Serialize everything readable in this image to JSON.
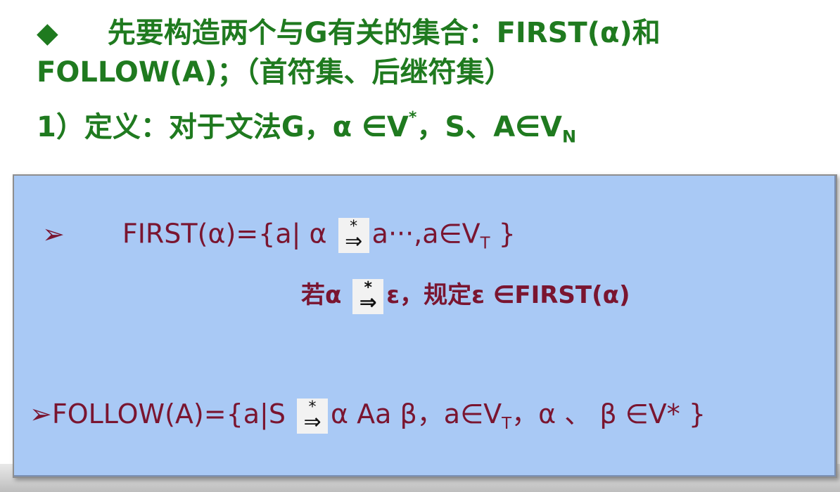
{
  "heading": {
    "diamond": "◆",
    "line1": "先要构造两个与G有关的集合：FIRST(α)和",
    "line2": "FOLLOW(A)；（首符集、后继符集）",
    "line3_main": "1）定义：对于文法G，α ∈V",
    "line3_sup": "*",
    "line3_mid": "，S、A∈V",
    "line3_sub": "N"
  },
  "definition_box": {
    "first": {
      "bullet": "➢",
      "lhs": "FIRST(α)={a| α ",
      "star": "*",
      "arrow": "⇒",
      "rhs": "a···,a∈V",
      "sub": "T",
      "close": " }"
    },
    "first_note": {
      "pre": "若α ",
      "star": "*",
      "arrow": "⇒",
      "post": "ε，规定ε ∈FIRST(α)"
    },
    "follow": {
      "bullet": "➢",
      "lhs": "FOLLOW(A)={a|S ",
      "star": "*",
      "arrow": "⇒",
      "rhs": "α Aa β，a∈V",
      "sub": "T",
      "rest": "，α 、 β ∈V* }"
    }
  }
}
